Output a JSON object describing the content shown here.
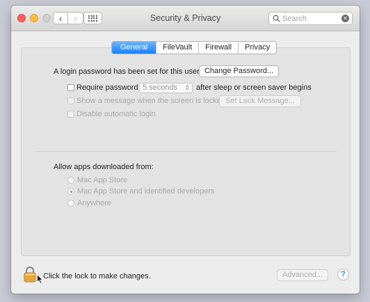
{
  "window": {
    "title": "Security & Privacy"
  },
  "toolbar": {
    "back_icon": "chevron-left",
    "forward_icon": "chevron-right",
    "show_all_icon": "grid-icon",
    "search_placeholder": "Search"
  },
  "tabs": [
    {
      "label": "General",
      "active": true
    },
    {
      "label": "FileVault",
      "active": false
    },
    {
      "label": "Firewall",
      "active": false
    },
    {
      "label": "Privacy",
      "active": false
    }
  ],
  "general": {
    "login_password_text": "A login password has been set for this user",
    "change_password_label": "Change Password...",
    "require_password_label": "Require password",
    "require_password_delay": "5 seconds",
    "require_password_suffix": "after sleep or screen saver begins",
    "show_message_label": "Show a message when the screen is locked",
    "set_lock_message_label": "Set Lock Message...",
    "disable_autologin_label": "Disable automatic login"
  },
  "downloads": {
    "heading": "Allow apps downloaded from:",
    "options": [
      {
        "label": "Mac App Store",
        "checked": false
      },
      {
        "label": "Mac App Store and identified developers",
        "checked": true
      },
      {
        "label": "Anywhere",
        "checked": false
      }
    ]
  },
  "footer": {
    "lock_text": "Click the lock to make changes.",
    "advanced_label": "Advanced...",
    "help_label": "?"
  },
  "colors": {
    "accent": "#1a82fb",
    "close": "#fc605c",
    "minimize": "#fdbc40",
    "lock_body": "#e7a63a"
  }
}
